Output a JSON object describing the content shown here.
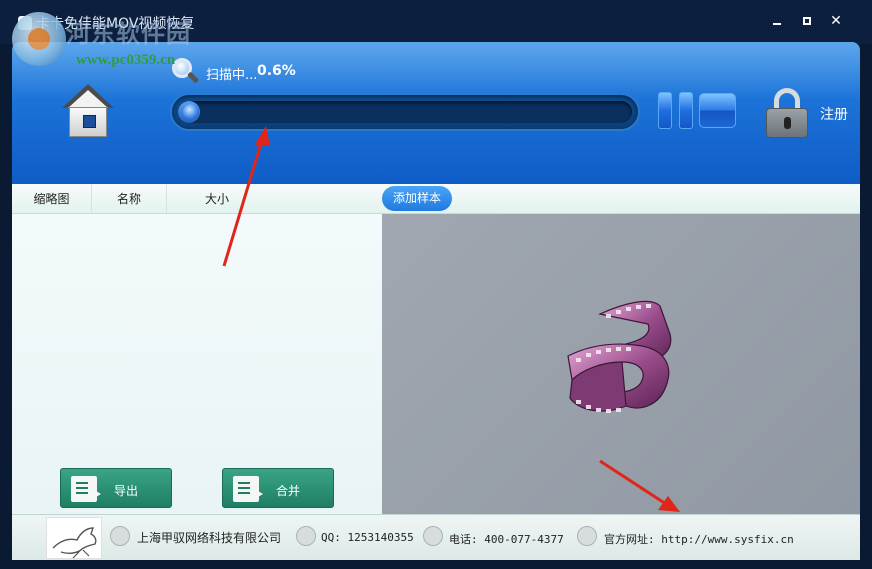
{
  "window": {
    "title": "卡卡免佳能MOV视频恢复",
    "watermark_cn": "河东软件园",
    "watermark_url": "www.pc0359.cn"
  },
  "header": {
    "scan_label": "扫描中...",
    "scan_percent": "0.6%",
    "progress": 0.006,
    "register_label": "注册"
  },
  "columns": {
    "thumbnail": "缩略图",
    "name": "名称",
    "size": "大小",
    "add_sample": "添加样本"
  },
  "actions": {
    "export": "导出",
    "merge": "合并"
  },
  "footer": {
    "company": "上海甲驭网络科技有限公司",
    "qq": "QQ: 1253140355",
    "phone": "电话: 400-077-4377",
    "website": "官方网址: http://www.sysfix.cn"
  },
  "colors": {
    "header_blue": "#1c73d8",
    "action_green": "#2a9276",
    "annotation_red": "#e0251b"
  }
}
